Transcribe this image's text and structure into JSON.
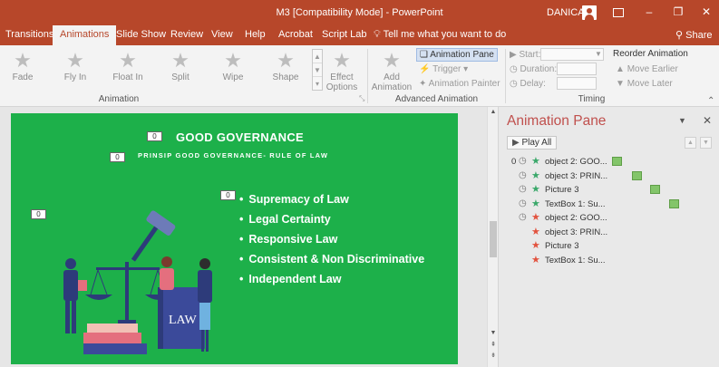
{
  "window": {
    "title": "M3 [Compatibility Mode] - PowerPoint",
    "user": "DANICA",
    "minimize_glyph": "–",
    "restore_glyph": "❐",
    "close_glyph": "✕"
  },
  "tabs": [
    "Transitions",
    "Animations",
    "Slide Show",
    "Review",
    "View",
    "Help",
    "Acrobat",
    "Script Lab"
  ],
  "active_tab": "Animations",
  "tell_me": "Tell me what you want to do",
  "share": "Share",
  "ribbon": {
    "animation_gallery": [
      "Fade",
      "Fly In",
      "Float In",
      "Split",
      "Wipe",
      "Shape"
    ],
    "effect_options": "Effect",
    "effect_options_2": "Options",
    "animation_group_label": "Animation",
    "add_animation": "Add",
    "add_animation_2": "Animation",
    "animation_pane": "Animation Pane",
    "trigger": "Trigger",
    "animation_painter": "Animation Painter",
    "advanced_group_label": "Advanced Animation",
    "start": "Start:",
    "duration": "Duration:",
    "delay": "Delay:",
    "reorder": "Reorder Animation",
    "move_earlier": "Move Earlier",
    "move_later": "Move Later",
    "timing_group_label": "Timing"
  },
  "slide": {
    "title": "GOOD GOVERNANCE",
    "subtitle": "PRINSIP GOOD GOVERNANCE- RULE OF LAW",
    "tag": "0",
    "bullets": [
      "Supremacy of Law",
      "Legal Certainty",
      "Responsive Law",
      "Consistent & Non Discriminative",
      "Independent Law"
    ],
    "book_label": "LAW"
  },
  "pane": {
    "title": "Animation Pane",
    "play_all": "Play All",
    "items": [
      {
        "num": "0",
        "clock": true,
        "star": "green",
        "name": "object 2: GOO...",
        "bar": true
      },
      {
        "num": "",
        "clock": true,
        "star": "green",
        "name": "object 3: PRIN...",
        "bar": true
      },
      {
        "num": "",
        "clock": true,
        "star": "green",
        "name": "Picture 3",
        "bar": true
      },
      {
        "num": "",
        "clock": true,
        "star": "green",
        "name": "TextBox 1: Su...",
        "bar": true
      },
      {
        "num": "",
        "clock": true,
        "star": "red",
        "name": "object 2: GOO...",
        "bar": false
      },
      {
        "num": "",
        "clock": false,
        "star": "red",
        "name": "object 3: PRIN...",
        "bar": false
      },
      {
        "num": "",
        "clock": false,
        "star": "red",
        "name": "Picture 3",
        "bar": false
      },
      {
        "num": "",
        "clock": false,
        "star": "red",
        "name": "TextBox 1: Su...",
        "bar": false
      }
    ]
  },
  "colors": {
    "accent": "#b7472a",
    "slide_bg": "#1db04a",
    "pane_title": "#c0504d"
  }
}
